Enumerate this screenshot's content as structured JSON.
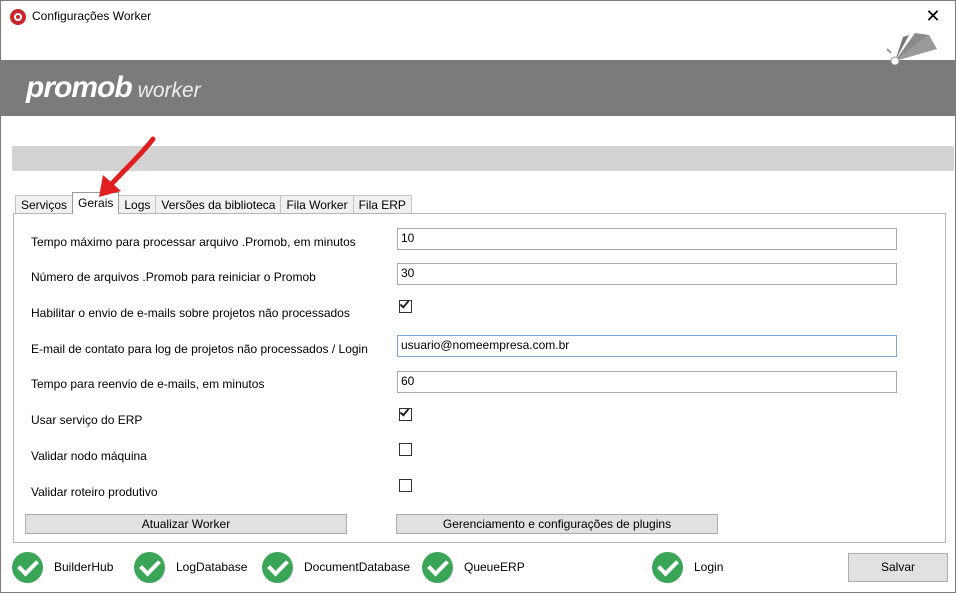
{
  "window": {
    "title": "Configurações Worker",
    "close_glyph": "✕"
  },
  "header": {
    "logo_main": "promob",
    "logo_sub": "worker",
    "icon": "fan-logo-icon"
  },
  "tabs": [
    {
      "label": "Serviços",
      "active": false
    },
    {
      "label": "Gerais",
      "active": true
    },
    {
      "label": "Logs",
      "active": false
    },
    {
      "label": "Versões da biblioteca",
      "active": false
    },
    {
      "label": "Fila Worker",
      "active": false
    },
    {
      "label": "Fila ERP",
      "active": false
    }
  ],
  "settings": {
    "max_time_label": "Tempo máximo para processar arquivo .Promob, em minutos",
    "max_time_value": "10",
    "restart_count_label": "Número de arquivos .Promob para reiniciar o Promob",
    "restart_count_value": "30",
    "email_enable_label": "Habilitar o envio de e-mails sobre projetos não processados",
    "email_enable_checked": true,
    "contact_email_label": "E-mail de contato para log de projetos não processados / Login",
    "contact_email_value": "usuario@nomeempresa.com.br",
    "resend_time_label": "Tempo para reenvio de e-mails, em minutos",
    "resend_time_value": "60",
    "erp_service_label": "Usar serviço do ERP",
    "erp_service_checked": true,
    "validate_node_label": "Validar nodo máquina",
    "validate_node_checked": false,
    "validate_route_label": "Validar roteiro produtivo",
    "validate_route_checked": false
  },
  "buttons": {
    "update_worker": "Atualizar Worker",
    "plugins": "Gerenciamento e configurações de plugins",
    "save": "Salvar"
  },
  "status": [
    {
      "label": "BuilderHub",
      "state": "ok",
      "color": "#3aa457"
    },
    {
      "label": "LogDatabase",
      "state": "ok",
      "color": "#3aa457"
    },
    {
      "label": "DocumentDatabase",
      "state": "ok",
      "color": "#3aa457"
    },
    {
      "label": "QueueERP",
      "state": "ok",
      "color": "#3aa457"
    },
    {
      "label": "Login",
      "state": "ok",
      "color": "#3aa457"
    }
  ],
  "colors": {
    "header": "#7b7b7b",
    "accent_red": "#e02020",
    "ok_green": "#3aa457"
  }
}
